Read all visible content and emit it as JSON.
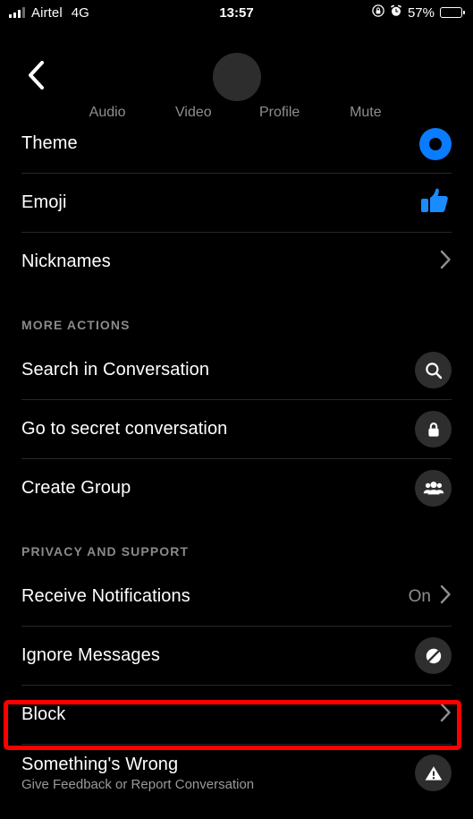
{
  "status_bar": {
    "carrier": "Airtel",
    "network": "4G",
    "time": "13:57",
    "battery_percent": "57%",
    "battery_level": 57,
    "icons": [
      "signal-bars-icon",
      "rotation-lock-icon",
      "alarm-clock-icon",
      "battery-icon"
    ]
  },
  "header": {
    "back_icon": "chevron-left-icon",
    "avatar_icon": "avatar",
    "tabs": [
      {
        "label": "Audio",
        "icon": "audio-icon"
      },
      {
        "label": "Video",
        "icon": "video-icon"
      },
      {
        "label": "Profile",
        "icon": "profile-icon"
      },
      {
        "label": "Mute",
        "icon": "mute-icon"
      }
    ]
  },
  "sections": [
    {
      "header": "",
      "rows": [
        {
          "label": "Theme",
          "sub": "",
          "value": "",
          "accessory": "theme-dot",
          "icon": "theme-color-circle-icon"
        },
        {
          "label": "Emoji",
          "sub": "",
          "value": "",
          "accessory": "emoji",
          "icon": "thumbs-up-icon"
        },
        {
          "label": "Nicknames",
          "sub": "",
          "value": "",
          "accessory": "chevron",
          "icon": "chevron-right-icon"
        }
      ]
    },
    {
      "header": "MORE ACTIONS",
      "rows": [
        {
          "label": "Search in Conversation",
          "sub": "",
          "value": "",
          "accessory": "circle-icon",
          "icon": "search-icon"
        },
        {
          "label": "Go to secret conversation",
          "sub": "",
          "value": "",
          "accessory": "circle-icon",
          "icon": "lock-icon"
        },
        {
          "label": "Create Group",
          "sub": "",
          "value": "",
          "accessory": "circle-icon",
          "icon": "group-people-icon"
        }
      ]
    },
    {
      "header": "PRIVACY AND SUPPORT",
      "rows": [
        {
          "label": "Receive Notifications",
          "sub": "",
          "value": "On",
          "accessory": "value-chevron",
          "icon": "chevron-right-icon"
        },
        {
          "label": "Ignore Messages",
          "sub": "",
          "value": "",
          "accessory": "circle-icon",
          "icon": "ignore-slash-icon"
        },
        {
          "label": "Block",
          "sub": "",
          "value": "",
          "accessory": "chevron",
          "icon": "chevron-right-icon"
        },
        {
          "label": "Something's Wrong",
          "sub": "Give Feedback or Report Conversation",
          "value": "",
          "accessory": "circle-icon",
          "icon": "warning-triangle-icon"
        }
      ]
    }
  ],
  "annotation": {
    "target_label": "Block",
    "color": "#ff0000"
  },
  "colors": {
    "background": "#000000",
    "accent_blue": "#0a7cff",
    "text_primary": "#ffffff",
    "text_secondary": "#8e8e8e",
    "divider": "#272727",
    "icon_circle": "#2e2e2e",
    "highlight_red": "#ff0000"
  }
}
